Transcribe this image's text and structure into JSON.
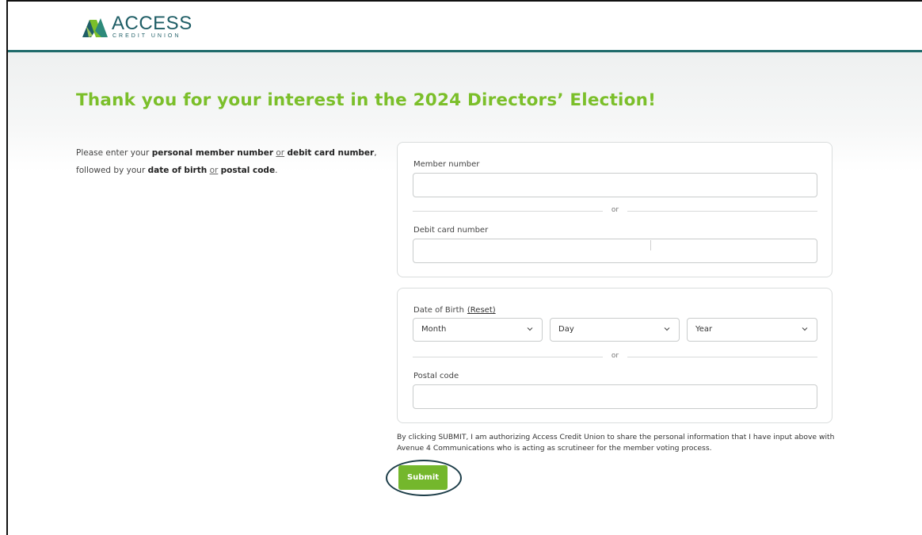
{
  "header": {
    "logo_main": "ACCESS",
    "logo_sub": "CREDIT UNION",
    "brand_colors": {
      "accent_green": "#7bbf2a",
      "brand_teal": "#1f6b6b",
      "button_green": "#74b72c"
    }
  },
  "page": {
    "title": "Thank you for your interest in the 2024 Directors’ Election!"
  },
  "instructions": {
    "part1": "Please enter your ",
    "member_number": "personal member number",
    "or1": "or",
    "debit_card": "debit card number",
    "part2": ",",
    "part3": "followed by your ",
    "dob": "date of birth",
    "or2": "or",
    "postal": "postal code",
    "end": "."
  },
  "form": {
    "member_number": {
      "label": "Member number",
      "value": ""
    },
    "divider1": "or",
    "debit_card": {
      "label": "Debit card number",
      "value": ""
    },
    "dob": {
      "label": "Date of Birth",
      "reset_label": "(Reset)",
      "month": "Month",
      "day": "Day",
      "year": "Year"
    },
    "divider2": "or",
    "postal_code": {
      "label": "Postal code",
      "value": ""
    }
  },
  "disclaimer": "By clicking SUBMIT, I am authorizing Access Credit Union to share the personal information that I have input above with Avenue 4 Communications who is acting as scrutineer for the member voting process.",
  "submit_label": "Submit",
  "icons": [
    "access-logo-icon",
    "chevron-down-icon"
  ]
}
